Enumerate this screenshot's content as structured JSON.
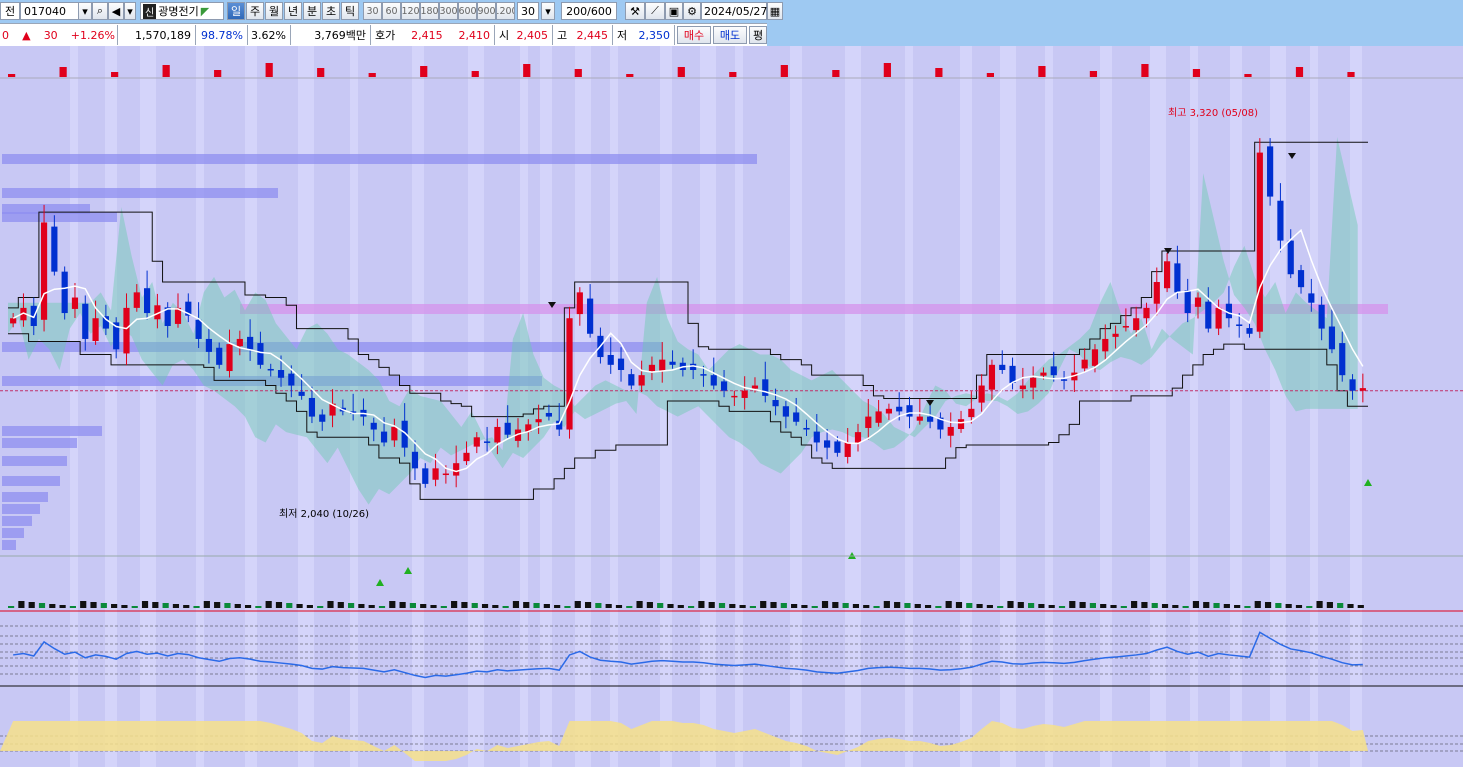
{
  "toolbar": {
    "prefix_label": "전",
    "code": "017040",
    "market_badge": "신",
    "stock_name": "광명전기",
    "periods": [
      "일",
      "주",
      "월",
      "년",
      "분",
      "초",
      "틱"
    ],
    "active_period": "일",
    "minute_steps": [
      "30",
      "60",
      "120",
      "180",
      "300",
      "600",
      "900",
      "1200"
    ],
    "interval_value": "30",
    "count_display": "200/600",
    "date": "2024/05/27"
  },
  "quote": {
    "price": "0",
    "change_arrow": "▲",
    "change": "30",
    "change_pct": "+1.26%",
    "volume": "1,570,189",
    "volume_ratio": "98.78%",
    "turnover": "3.62%",
    "amount": "3,769백만",
    "ask_label": "호가",
    "ask": "2,415",
    "bid": "2,410",
    "open_label": "시",
    "open": "2,405",
    "high_label": "고",
    "high": "2,445",
    "low_label": "저",
    "low": "2,350",
    "buy_label": "매수",
    "sell_label": "매도",
    "extra_label": "평"
  },
  "annotations": {
    "high_note": "최고 3,320 (05/08)",
    "low_note": "최저 2,040 (10/26)"
  },
  "colors": {
    "up": "#e0001b",
    "down": "#0030d0",
    "cloud": "#2fa88a",
    "chart_bg": "#c8c8f4"
  },
  "chart_data": {
    "type": "candlestick",
    "price_range": [
      1800,
      3500
    ],
    "ref_price": 2400,
    "closes": [
      2680,
      2720,
      2650,
      3050,
      2860,
      2700,
      2760,
      2600,
      2680,
      2640,
      2560,
      2720,
      2780,
      2700,
      2730,
      2650,
      2720,
      2690,
      2600,
      2550,
      2500,
      2580,
      2600,
      2560,
      2500,
      2480,
      2450,
      2420,
      2380,
      2300,
      2280,
      2350,
      2320,
      2310,
      2300,
      2250,
      2200,
      2260,
      2180,
      2100,
      2040,
      2100,
      2080,
      2120,
      2160,
      2220,
      2200,
      2260,
      2230,
      2250,
      2270,
      2290,
      2300,
      2250,
      2680,
      2780,
      2620,
      2530,
      2500,
      2480,
      2420,
      2460,
      2500,
      2520,
      2500,
      2480,
      2480,
      2460,
      2420,
      2400,
      2380,
      2400,
      2420,
      2380,
      2340,
      2300,
      2280,
      2250,
      2200,
      2180,
      2160,
      2200,
      2240,
      2300,
      2320,
      2330,
      2320,
      2300,
      2300,
      2280,
      2250,
      2260,
      2290,
      2330,
      2420,
      2500,
      2480,
      2430,
      2420,
      2450,
      2470,
      2460,
      2440,
      2470,
      2520,
      2560,
      2600,
      2620,
      2650,
      2680,
      2720,
      2820,
      2900,
      2780,
      2700,
      2760,
      2640,
      2720,
      2680,
      2650,
      2620,
      3320,
      3150,
      2980,
      2850,
      2800,
      2740,
      2640,
      2560,
      2460,
      2400,
      2410
    ],
    "high": "3,320",
    "low": "2,040"
  }
}
